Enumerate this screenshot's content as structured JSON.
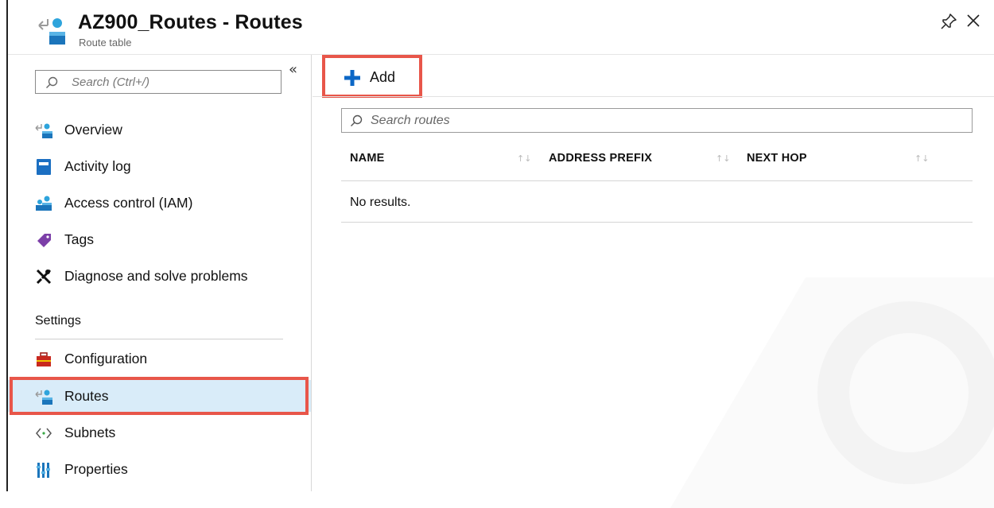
{
  "header": {
    "title": "AZ900_Routes - Routes",
    "subtitle": "Route table",
    "icons": {
      "resource": "route-table-icon",
      "pin": "pin-icon",
      "close": "close-icon"
    }
  },
  "sidebar": {
    "search_placeholder": "Search (Ctrl+/)",
    "collapse_label": "«",
    "items": [
      {
        "label": "Overview",
        "icon": "route-table-icon"
      },
      {
        "label": "Activity log",
        "icon": "activity-log-icon"
      },
      {
        "label": "Access control (IAM)",
        "icon": "access-control-icon"
      },
      {
        "label": "Tags",
        "icon": "tag-icon"
      },
      {
        "label": "Diagnose and solve problems",
        "icon": "wrench-icon"
      }
    ],
    "settings_label": "Settings",
    "settings_items": [
      {
        "label": "Configuration",
        "icon": "toolbox-icon"
      },
      {
        "label": "Routes",
        "icon": "route-table-icon",
        "selected": true
      },
      {
        "label": "Subnets",
        "icon": "subnets-icon"
      },
      {
        "label": "Properties",
        "icon": "properties-icon"
      }
    ]
  },
  "main": {
    "add_label": "Add",
    "search_placeholder": "Search routes",
    "columns": [
      "NAME",
      "ADDRESS PREFIX",
      "NEXT HOP"
    ],
    "sort_glyph": "↑↓",
    "empty_text": "No results."
  },
  "colors": {
    "highlight": "#e8564a",
    "accent": "#0b67c6",
    "selected_bg": "#d9ecf9"
  }
}
